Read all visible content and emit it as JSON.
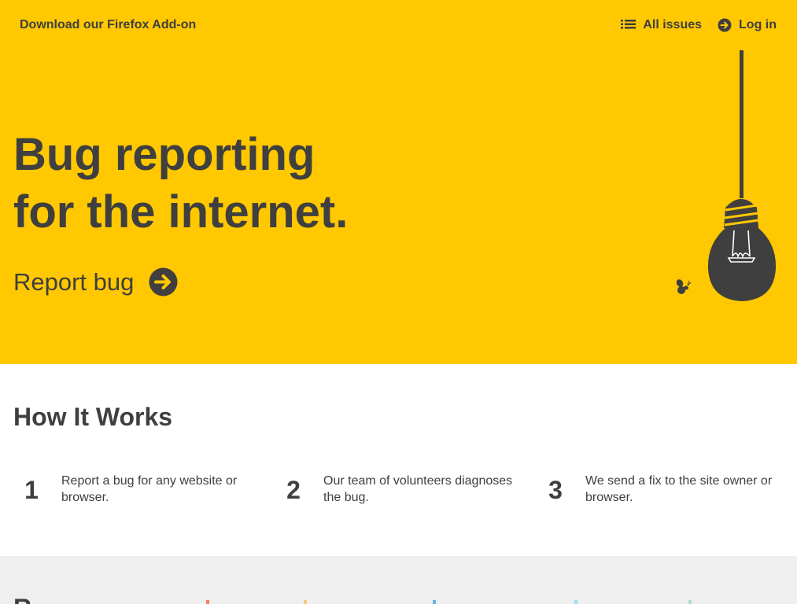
{
  "header": {
    "addon_link": "Download our Firefox Add-on",
    "nav": {
      "all_issues": "All issues",
      "login": "Log in"
    }
  },
  "hero": {
    "headline_line1": "Bug reporting",
    "headline_line2": "for the internet.",
    "cta": "Report bug"
  },
  "how_it_works": {
    "title": "How It Works",
    "steps": [
      {
        "number": "1",
        "text": "Report a bug for any website or browser."
      },
      {
        "number": "2",
        "text": "Our team of volunteers diagnoses the bug."
      },
      {
        "number": "3",
        "text": "We send a fix to the site owner or browser."
      }
    ]
  },
  "bottom_section": {
    "title_partial": "R",
    "tick_colors": [
      "#f08060",
      "#f8c880",
      "#60b8e0",
      "#a8d8f0",
      "#b0d8d0"
    ]
  },
  "colors": {
    "hero_bg": "#ffc800",
    "text": "#3f3f3f",
    "bottom_bg": "#efefef"
  }
}
